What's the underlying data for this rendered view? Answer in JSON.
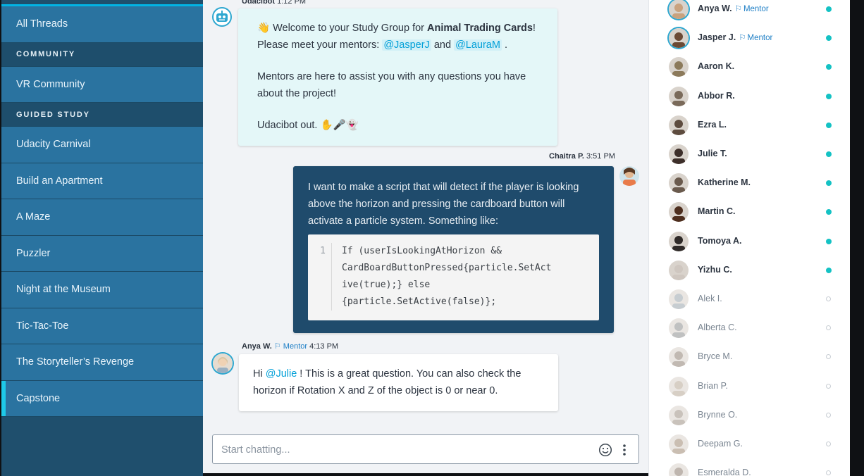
{
  "sidebar": {
    "items": [
      {
        "type": "item",
        "label": "All Threads"
      },
      {
        "type": "header",
        "label": "COMMUNITY"
      },
      {
        "type": "item",
        "label": "VR Community"
      },
      {
        "type": "header",
        "label": "GUIDED STUDY"
      },
      {
        "type": "item",
        "label": "Udacity Carnival"
      },
      {
        "type": "item",
        "label": "Build an Apartment"
      },
      {
        "type": "item",
        "label": "A Maze"
      },
      {
        "type": "item",
        "label": "Puzzler"
      },
      {
        "type": "item",
        "label": "Night at the Museum"
      },
      {
        "type": "item",
        "label": "Tic-Tac-Toe"
      },
      {
        "type": "item",
        "label": "The Storyteller’s Revenge"
      },
      {
        "type": "item",
        "label": "Capstone",
        "active": true
      }
    ]
  },
  "messages": {
    "bot": {
      "author": "Udacibot",
      "time": "1:12 PM",
      "p1_pre": "Welcome to your Study Group for ",
      "p1_bold": "Animal Trading Cards",
      "p1_post": "!",
      "p1b_pre": "Please meet your mentors: ",
      "mention1": "@JasperJ",
      "p1b_and": " and ",
      "mention2": "@LauraM",
      "p1b_post": " .",
      "p2": "Mentors are here to assist you with any questions you have about the project!",
      "p3": "Udacibot out. ",
      "p3_emoji": "✋🎤👻",
      "wave_emoji": "👋"
    },
    "chaitra": {
      "author": "Chaitra P.",
      "time": "3:51 PM",
      "text": "I want to make a script that will detect if the player is looking above the horizon and pressing the cardboard button will activate a particle system. Something like:",
      "code_line_no": "1",
      "code": "If (userIsLookingAtHorizon &&\nCardBoardButtonPressed{particle.SetAct\nive(true);} else\n{particle.SetActive(false)};"
    },
    "anya": {
      "author": "Anya W.",
      "role": "Mentor",
      "time": "4:13 PM",
      "pre": "Hi ",
      "mention": "@Julie",
      "post": " ! This is a great question. You can also check the horizon if Rotation X and Z of the object is 0 or near 0."
    }
  },
  "composer": {
    "placeholder": "Start chatting..."
  },
  "members": [
    {
      "name": "Anya W.",
      "role": "Mentor",
      "online": true,
      "color": "#c9a27e"
    },
    {
      "name": "Jasper J.",
      "role": "Mentor",
      "online": true,
      "color": "#6b4a35"
    },
    {
      "name": "Aaron K.",
      "role": "",
      "online": true,
      "color": "#8c7a5b"
    },
    {
      "name": "Abbor R.",
      "role": "",
      "online": true,
      "color": "#7a6a5a"
    },
    {
      "name": "Ezra L.",
      "role": "",
      "online": true,
      "color": "#5e4c3f"
    },
    {
      "name": "Julie T.",
      "role": "",
      "online": true,
      "color": "#3d2f2a"
    },
    {
      "name": "Katherine M.",
      "role": "",
      "online": true,
      "color": "#6a5a4d"
    },
    {
      "name": "Martin C.",
      "role": "",
      "online": true,
      "color": "#4d2e1e"
    },
    {
      "name": "Tomoya A.",
      "role": "",
      "online": true,
      "color": "#2f2a28"
    },
    {
      "name": "Yizhu C.",
      "role": "",
      "online": true,
      "color": "#cfc7c0"
    },
    {
      "name": "Alek I.",
      "role": "",
      "online": false,
      "color": "#9aa5ad"
    },
    {
      "name": "Alberta C.",
      "role": "",
      "online": false,
      "color": "#8e8f90"
    },
    {
      "name": "Bryce M.",
      "role": "",
      "online": false,
      "color": "#8f8075"
    },
    {
      "name": "Brian P.",
      "role": "",
      "online": false,
      "color": "#b8a896"
    },
    {
      "name": "Brynne O.",
      "role": "",
      "online": false,
      "color": "#9e9285"
    },
    {
      "name": "Deepam G.",
      "role": "",
      "online": false,
      "color": "#a08a75"
    },
    {
      "name": "Esmeralda D.",
      "role": "",
      "online": false,
      "color": "#8c7c6e"
    }
  ],
  "colors": {
    "accent": "#02b3e4",
    "online": "#14c2c4",
    "sidebar": "#2a73a0",
    "own_bubble": "#1f4b6c"
  }
}
